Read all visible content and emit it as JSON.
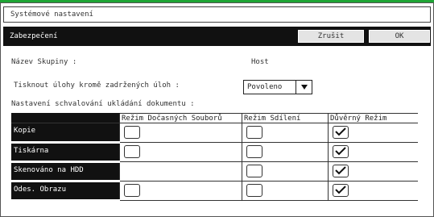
{
  "window": {
    "title": "Systémové nastavení"
  },
  "header": {
    "title": "Zabezpečení",
    "cancel_label": "Zrušit",
    "ok_label": "OK"
  },
  "group": {
    "label": "Název Skupiny :",
    "value": "Host"
  },
  "print_jobs": {
    "label": "Tisknout úlohy kromě zadržených úloh :",
    "value": "Povoleno"
  },
  "approval": {
    "label": "Nastavení schvalování ukládání dokumentu :",
    "columns": [
      "Režim Dočasných Souborů",
      "Režim Sdílení",
      "Důvěrný Režim"
    ],
    "rows": [
      {
        "label": "Kopie",
        "checks": [
          false,
          false,
          true
        ],
        "present": [
          true,
          true,
          true
        ]
      },
      {
        "label": "Tiskárna",
        "checks": [
          false,
          false,
          true
        ],
        "present": [
          true,
          true,
          true
        ]
      },
      {
        "label": "Skenováno na HDD",
        "checks": [
          false,
          false,
          true
        ],
        "present": [
          false,
          true,
          true
        ]
      },
      {
        "label": "Odes. Obrazu",
        "checks": [
          false,
          false,
          true
        ],
        "present": [
          true,
          true,
          true
        ]
      }
    ]
  },
  "icons": {
    "checkbox_checked": "checkmark-icon",
    "dropdown": "triangle-down-icon"
  },
  "colors": {
    "accent": "#1fa535",
    "header_bg": "#111111"
  }
}
